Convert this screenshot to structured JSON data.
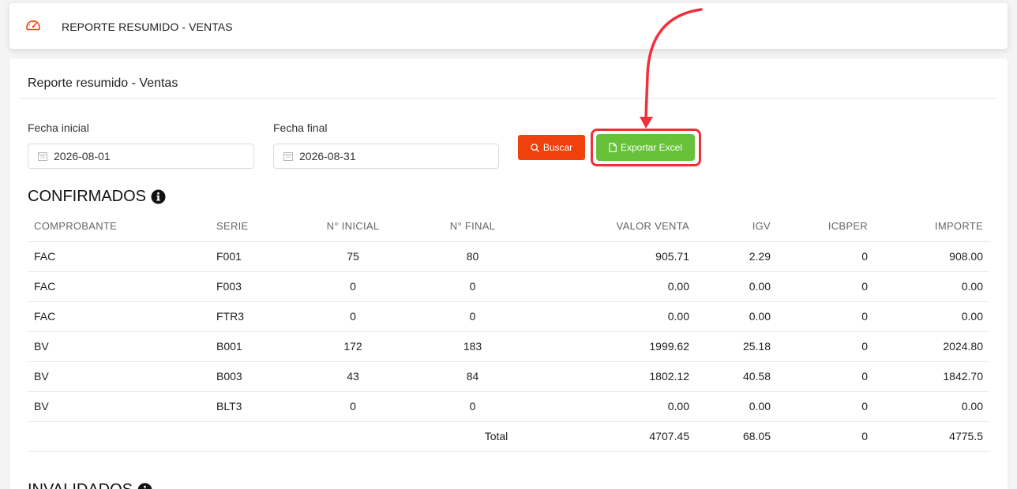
{
  "header": {
    "title": "REPORTE RESUMIDO - VENTAS",
    "icon": "dashboard-gauge-icon"
  },
  "card": {
    "title": "Reporte resumido - Ventas"
  },
  "filters": {
    "start_label": "Fecha inicial",
    "start_value": "2026-08-01",
    "end_label": "Fecha final",
    "end_value": "2026-08-31",
    "search_label": "Buscar",
    "export_label": "Exportar Excel"
  },
  "colors": {
    "accent": "#f0400c",
    "export": "#67c23a",
    "annotation": "#f0303a"
  },
  "confirmed": {
    "title": "CONFIRMADOS",
    "columns": [
      "COMPROBANTE",
      "SERIE",
      "N° INICIAL",
      "N° FINAL",
      "VALOR VENTA",
      "IGV",
      "ICBPER",
      "IMPORTE"
    ],
    "rows": [
      [
        "FAC",
        "F001",
        "75",
        "80",
        "905.71",
        "2.29",
        "0",
        "908.00"
      ],
      [
        "FAC",
        "F003",
        "0",
        "0",
        "0.00",
        "0.00",
        "0",
        "0.00"
      ],
      [
        "FAC",
        "FTR3",
        "0",
        "0",
        "0.00",
        "0.00",
        "0",
        "0.00"
      ],
      [
        "BV",
        "B001",
        "172",
        "183",
        "1999.62",
        "25.18",
        "0",
        "2024.80"
      ],
      [
        "BV",
        "B003",
        "43",
        "84",
        "1802.12",
        "40.58",
        "0",
        "1842.70"
      ],
      [
        "BV",
        "BLT3",
        "0",
        "0",
        "0.00",
        "0.00",
        "0",
        "0.00"
      ]
    ],
    "total": {
      "label": "Total",
      "valor_venta": "4707.45",
      "igv": "68.05",
      "icbper": "0",
      "importe": "4775.5"
    }
  },
  "invalidated": {
    "title": "INVALIDADOS"
  }
}
